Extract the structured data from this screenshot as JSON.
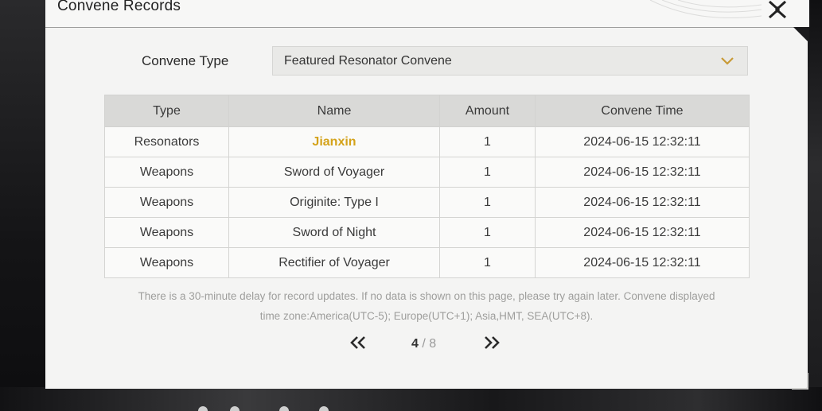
{
  "window": {
    "title": "Convene Records"
  },
  "filter": {
    "label": "Convene Type",
    "selected": "Featured Resonator Convene"
  },
  "table": {
    "headers": [
      "Type",
      "Name",
      "Amount",
      "Convene Time"
    ],
    "rows": [
      {
        "type": "Resonators",
        "name": "Jianxin",
        "amount": "1",
        "time": "2024-06-15 12:32:11",
        "highlight": true
      },
      {
        "type": "Weapons",
        "name": "Sword of Voyager",
        "amount": "1",
        "time": "2024-06-15 12:32:11"
      },
      {
        "type": "Weapons",
        "name": "Originite: Type I",
        "amount": "1",
        "time": "2024-06-15 12:32:11"
      },
      {
        "type": "Weapons",
        "name": "Sword of Night",
        "amount": "1",
        "time": "2024-06-15 12:32:11"
      },
      {
        "type": "Weapons",
        "name": "Rectifier of Voyager",
        "amount": "1",
        "time": "2024-06-15 12:32:11"
      }
    ]
  },
  "notice": {
    "line1": "There is a 30-minute delay for record updates. If no data is shown on this page, please try again later. Convene displayed",
    "line2": "time zone:America(UTC-5); Europe(UTC+1); Asia,HMT, SEA(UTC+8)."
  },
  "pagination": {
    "current": "4",
    "separator": "/",
    "total": "8",
    "prev_icon": "double-chevron-left-icon",
    "next_icon": "double-chevron-right-icon"
  },
  "colors": {
    "highlight_gold": "#d4a21a",
    "panel_bg": "#f4f4f3",
    "header_bg": "#d9d9d7"
  }
}
